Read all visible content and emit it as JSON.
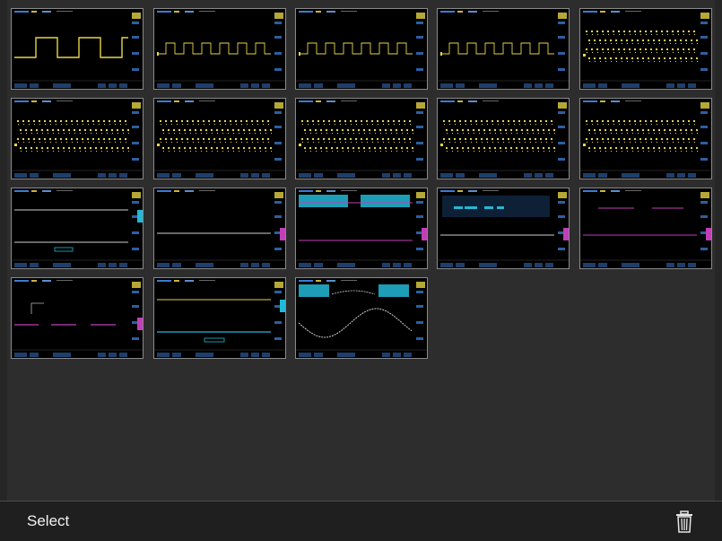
{
  "toolbar": {
    "select_label": "Select",
    "trash_icon": "trash-icon"
  },
  "colors": {
    "background": "#2d2d2d",
    "toolbar": "#1f1f1f",
    "ch1": "#e8d44a",
    "ch2": "#22b8d6",
    "ch3": "#c03fb6"
  },
  "thumbnails": [
    {
      "kind": "square-wide",
      "trace": "yellow"
    },
    {
      "kind": "square-med",
      "trace": "yellow"
    },
    {
      "kind": "square-med",
      "trace": "yellow"
    },
    {
      "kind": "square-med",
      "trace": "yellow"
    },
    {
      "kind": "dense",
      "trace": "yellow"
    },
    {
      "kind": "dense",
      "trace": "yellow"
    },
    {
      "kind": "dense",
      "trace": "yellow"
    },
    {
      "kind": "dense",
      "trace": "yellow"
    },
    {
      "kind": "dense",
      "trace": "yellow"
    },
    {
      "kind": "dense",
      "trace": "yellow"
    },
    {
      "kind": "two-flat",
      "trace": "white-cyan"
    },
    {
      "kind": "flat-mid",
      "trace": "white"
    },
    {
      "kind": "bus-magenta",
      "trace": "magenta"
    },
    {
      "kind": "menu",
      "trace": "white"
    },
    {
      "kind": "magenta-pulse",
      "trace": "magenta"
    },
    {
      "kind": "magenta-pulse2",
      "trace": "magenta"
    },
    {
      "kind": "yellow-cyan",
      "trace": "yellow-cyan"
    },
    {
      "kind": "sine",
      "trace": "white"
    }
  ]
}
